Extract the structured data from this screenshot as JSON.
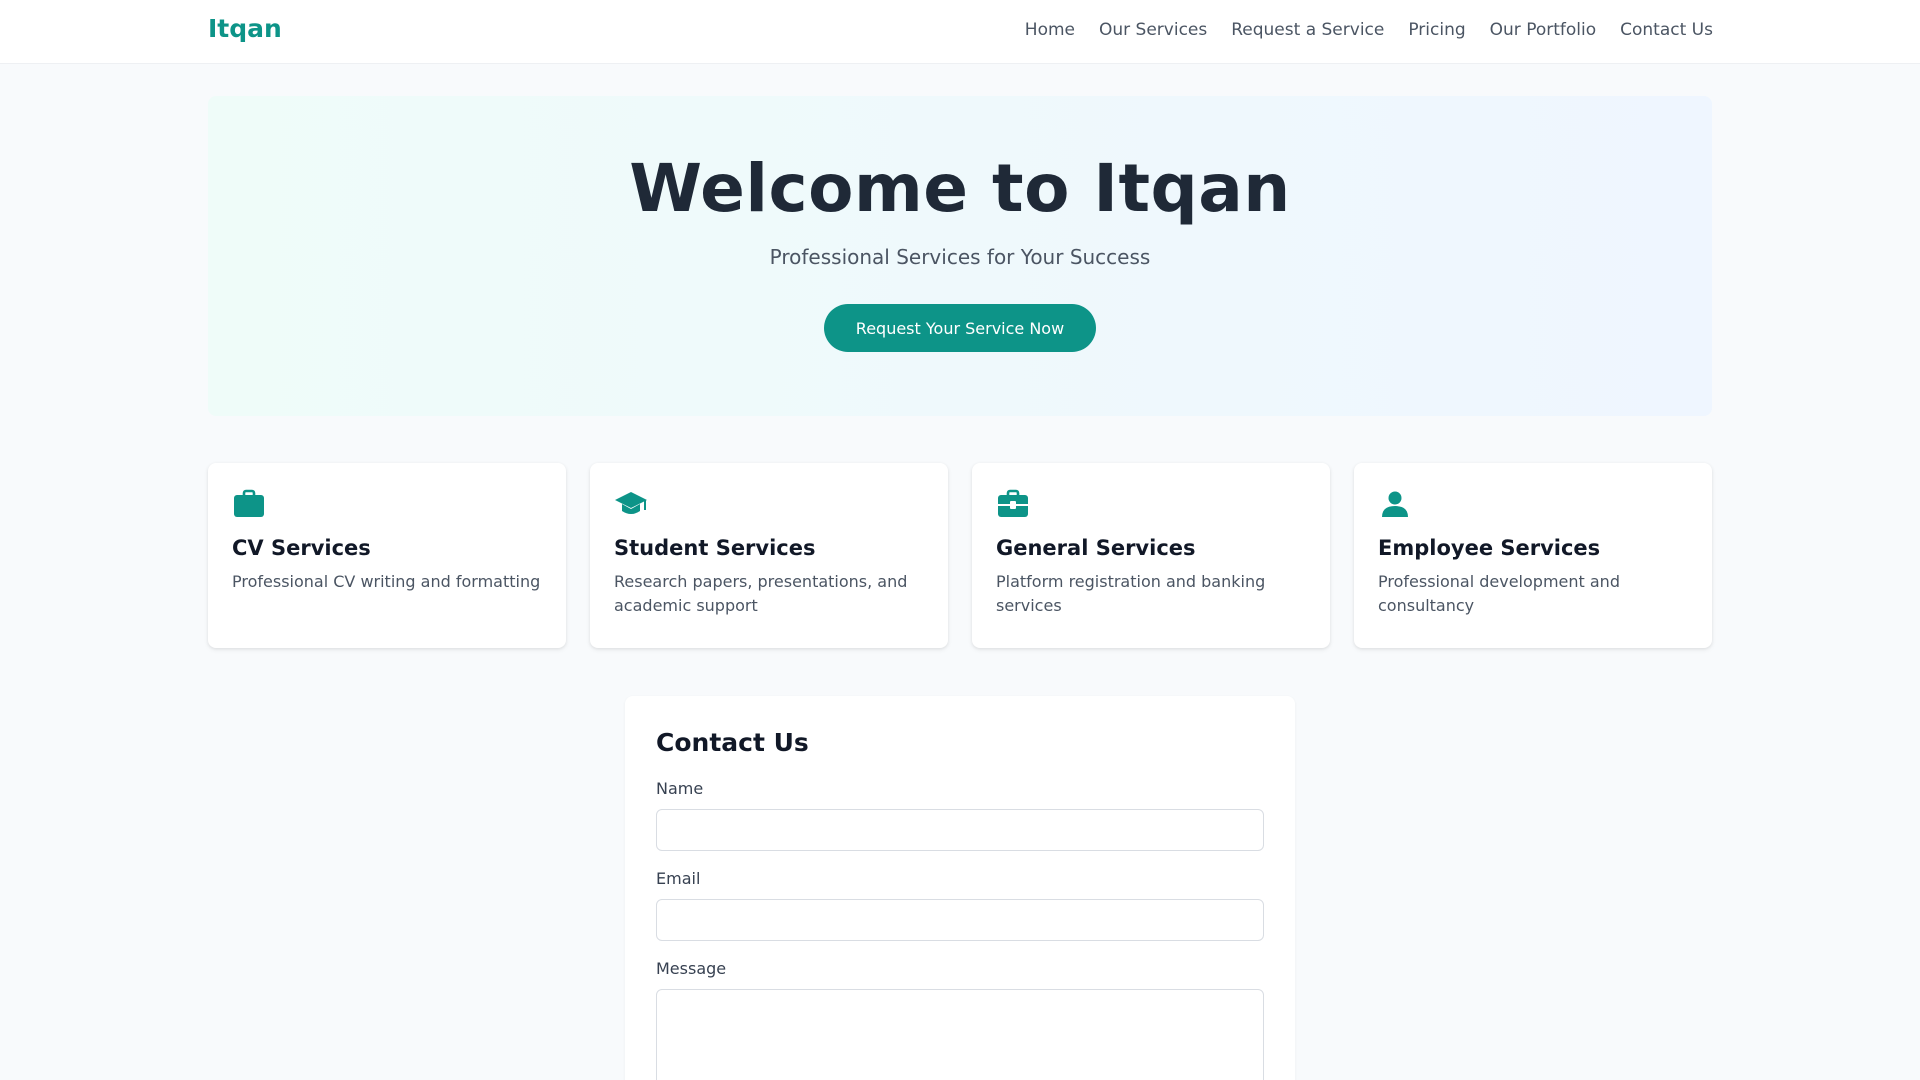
{
  "navbar": {
    "brand": "Itqan",
    "links": [
      "Home",
      "Our Services",
      "Request a Service",
      "Pricing",
      "Our Portfolio",
      "Contact Us"
    ]
  },
  "hero": {
    "title": "Welcome to Itqan",
    "subtitle": "Professional Services for Your Success",
    "cta_label": "Request Your Service Now"
  },
  "services": [
    {
      "icon": "briefcase-icon",
      "title": "CV Services",
      "description": "Professional CV writing and formatting"
    },
    {
      "icon": "graduation-cap-icon",
      "title": "Student Services",
      "description": "Research papers, presentations, and academic support"
    },
    {
      "icon": "toolbox-icon",
      "title": "General Services",
      "description": "Platform registration and banking services"
    },
    {
      "icon": "user-icon",
      "title": "Employee Services",
      "description": "Professional development and consultancy"
    }
  ],
  "contact": {
    "title": "Contact Us",
    "name_label": "Name",
    "email_label": "Email",
    "message_label": "Message",
    "name_value": "",
    "email_value": "",
    "message_value": ""
  },
  "colors": {
    "accent": "#0d9488",
    "heading": "#1f2937",
    "muted": "#4b5563",
    "background": "#f8fafc"
  }
}
